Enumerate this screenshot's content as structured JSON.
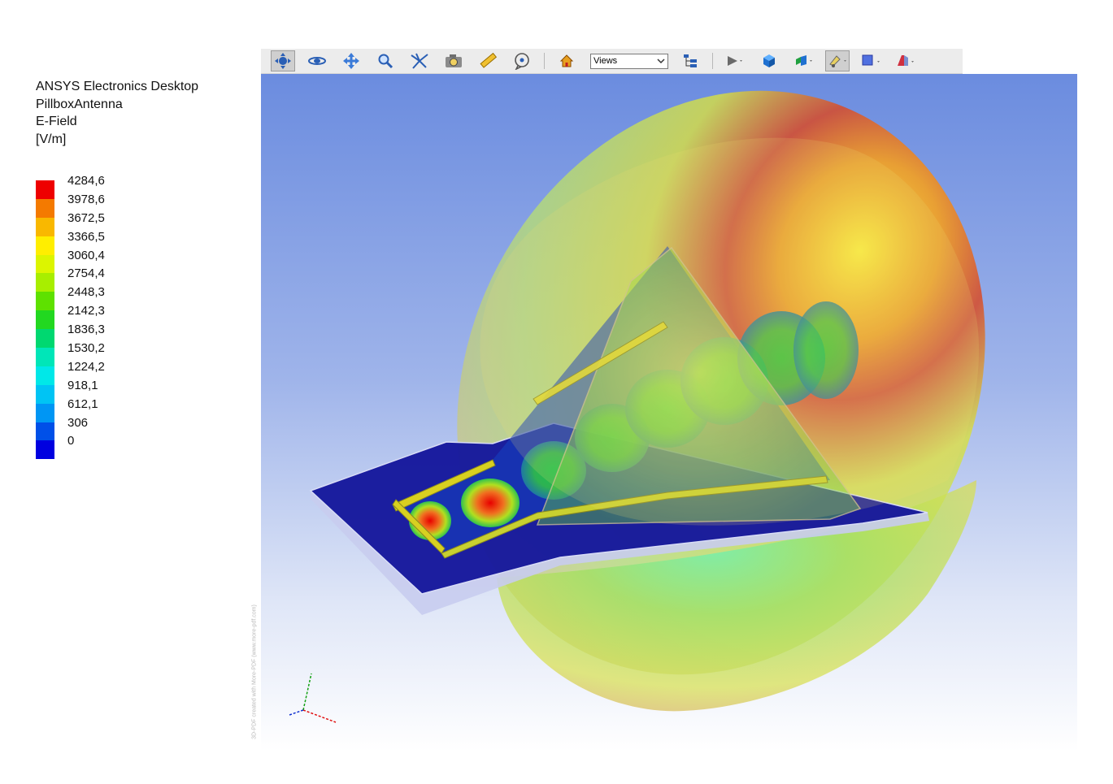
{
  "legend": {
    "app": "ANSYS Electronics Desktop",
    "project": "PillboxAntenna",
    "quantity": "E-Field",
    "unit": "[V/m]",
    "values": [
      "4284,6",
      "3978,6",
      "3672,5",
      "3366,5",
      "3060,4",
      "2754,4",
      "2448,3",
      "2142,3",
      "1836,3",
      "1530,2",
      "1224,2",
      "918,1",
      "612,1",
      "306",
      "0"
    ],
    "colors": [
      "#ee0000",
      "#f47a00",
      "#f9b800",
      "#ffee00",
      "#dcf500",
      "#a8ee00",
      "#5ee100",
      "#22d820",
      "#00d870",
      "#00e6b8",
      "#00e8e8",
      "#00c4f4",
      "#0096f4",
      "#0050e8",
      "#0000e0"
    ]
  },
  "toolbar": {
    "views_label": "Views"
  },
  "watermark": "3D-PDF created with More-PDF (www.more-pdf.com)",
  "axes": {
    "x_color": "#e01010",
    "y_color": "#10a010",
    "z_color": "#1030d0"
  }
}
